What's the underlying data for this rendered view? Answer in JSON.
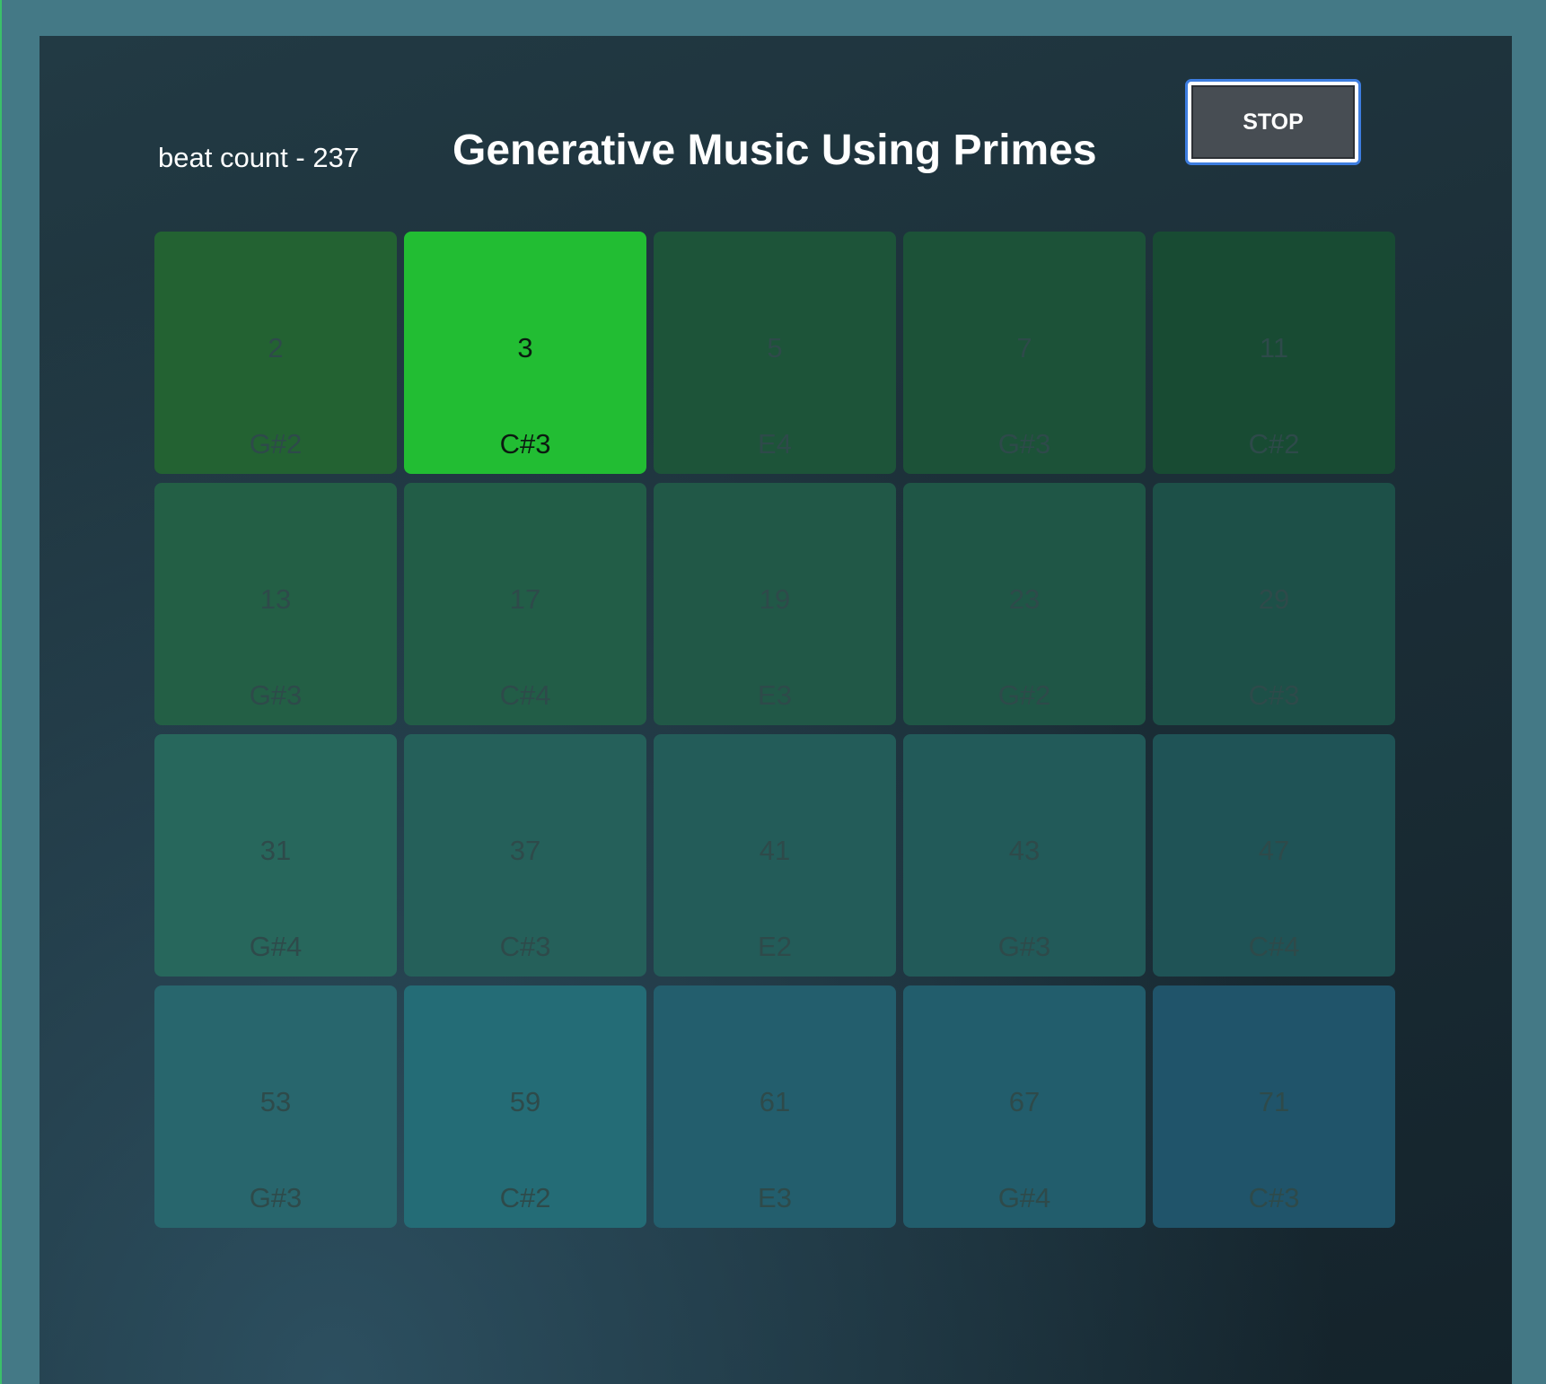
{
  "header": {
    "beat_count_label": "beat count - 237",
    "title": "Generative Music Using Primes",
    "stop_label": "STOP"
  },
  "colors": {
    "active_cell": "#22bd33",
    "active_text": "#0b1a10",
    "inactive_text": "#2e4a4a"
  },
  "cells": [
    {
      "number": "2",
      "note": "G#2",
      "active": false,
      "color": "#236232"
    },
    {
      "number": "3",
      "note": "C#3",
      "active": true,
      "color": "#22bd33"
    },
    {
      "number": "5",
      "note": "E4",
      "active": false,
      "color": "#1d5439"
    },
    {
      "number": "7",
      "note": "G#3",
      "active": false,
      "color": "#1c5238"
    },
    {
      "number": "11",
      "note": "C#2",
      "active": false,
      "color": "#184b33"
    },
    {
      "number": "13",
      "note": "G#3",
      "active": false,
      "color": "#235f45"
    },
    {
      "number": "17",
      "note": "C#4",
      "active": false,
      "color": "#225d47"
    },
    {
      "number": "19",
      "note": "E3",
      "active": false,
      "color": "#215847"
    },
    {
      "number": "23",
      "note": "G#2",
      "active": false,
      "color": "#1f5646"
    },
    {
      "number": "29",
      "note": "C#3",
      "active": false,
      "color": "#1d5048"
    },
    {
      "number": "31",
      "note": "G#4",
      "active": false,
      "color": "#27675c"
    },
    {
      "number": "37",
      "note": "C#3",
      "active": false,
      "color": "#25605a"
    },
    {
      "number": "41",
      "note": "E2",
      "active": false,
      "color": "#235c59"
    },
    {
      "number": "43",
      "note": "G#3",
      "active": false,
      "color": "#225a59"
    },
    {
      "number": "47",
      "note": "C#4",
      "active": false,
      "color": "#1f5356"
    },
    {
      "number": "53",
      "note": "G#3",
      "active": false,
      "color": "#28666d"
    },
    {
      "number": "59",
      "note": "C#2",
      "active": false,
      "color": "#246c76"
    },
    {
      "number": "61",
      "note": "E3",
      "active": false,
      "color": "#235e6d"
    },
    {
      "number": "67",
      "note": "G#4",
      "active": false,
      "color": "#225d6c"
    },
    {
      "number": "71",
      "note": "C#3",
      "active": false,
      "color": "#20546a"
    }
  ]
}
